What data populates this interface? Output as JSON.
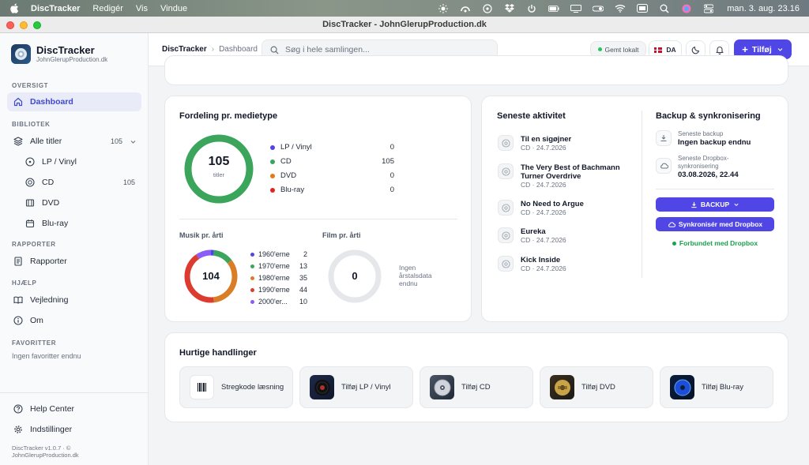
{
  "menubar": {
    "app_name": "DiscTracker",
    "items": [
      "Redigér",
      "Vis",
      "Vindue"
    ],
    "clock": "man. 3. aug.  23.16"
  },
  "window": {
    "title": "DiscTracker - JohnGlerupProduction.dk"
  },
  "sidebar": {
    "brand_title": "DiscTracker",
    "brand_subtitle": "JohnGlerupProduction.dk",
    "sections": {
      "overview": "OVERSIGT",
      "library": "BIBLIOTEK",
      "reports": "RAPPORTER",
      "help": "HJÆLP",
      "favorites": "FAVORITTER"
    },
    "dashboard": "Dashboard",
    "all_titles": {
      "label": "Alle titler",
      "count": "105"
    },
    "library_items": [
      {
        "label": "LP / Vinyl",
        "count": ""
      },
      {
        "label": "CD",
        "count": "105"
      },
      {
        "label": "DVD",
        "count": ""
      },
      {
        "label": "Blu-ray",
        "count": ""
      }
    ],
    "reports": "Rapporter",
    "guide": "Vejledning",
    "about": "Om",
    "favorites_empty": "Ingen favoritter endnu",
    "help_center": "Help Center",
    "settings": "Indstillinger",
    "version_line1": "DiscTracker v1.0.7 · ©",
    "version_line2": "JohnGlerupProduction.dk"
  },
  "topbar": {
    "breadcrumb_root": "DiscTracker",
    "breadcrumb_current": "Dashboard",
    "search_placeholder": "Søg i hele samlingen...",
    "saved_label": "Gemt lokalt",
    "lang": "DA",
    "add_label": "Tilføj"
  },
  "distribution": {
    "title": "Fordeling pr. medietype",
    "total": "105",
    "total_label": "titler",
    "legend": [
      {
        "label": "LP / Vinyl",
        "value": "0",
        "color": "#4f46e5"
      },
      {
        "label": "CD",
        "value": "105",
        "color": "#3ba55c"
      },
      {
        "label": "DVD",
        "value": "0",
        "color": "#e07b1a"
      },
      {
        "label": "Blu-ray",
        "value": "0",
        "color": "#dc2626"
      }
    ],
    "music_title": "Musik pr. årti",
    "music_total": "104",
    "decades": [
      {
        "label": "1960'erne",
        "value": "2",
        "color": "#4f46e5"
      },
      {
        "label": "1970'erne",
        "value": "13",
        "color": "#3ba55c"
      },
      {
        "label": "1980'erne",
        "value": "35",
        "color": "#d97d26"
      },
      {
        "label": "1990'erne",
        "value": "44",
        "color": "#dc3b2f"
      },
      {
        "label": "2000'er...",
        "value": "10",
        "color": "#8b5cf6"
      }
    ],
    "film_title": "Film pr. årti",
    "film_total": "0",
    "film_empty": [
      "Ingen",
      "årstalsdata",
      "endnu"
    ]
  },
  "activity": {
    "title": "Seneste aktivitet",
    "items": [
      {
        "title": "Til en sigøjner",
        "title2": "",
        "sub": "CD · 24.7.2026"
      },
      {
        "title": "The Very Best of Bachmann",
        "title2": "Turner Overdrive",
        "sub": "CD · 24.7.2026"
      },
      {
        "title": "No Need to Argue",
        "title2": "",
        "sub": "CD · 24.7.2026"
      },
      {
        "title": "Eureka",
        "title2": "",
        "sub": "CD · 24.7.2026"
      },
      {
        "title": "Kick Inside",
        "title2": "",
        "sub": "CD · 24.7.2026"
      }
    ]
  },
  "backup": {
    "title": "Backup & synkronisering",
    "last_backup_label": "Seneste backup",
    "last_backup_value": "Ingen backup endnu",
    "last_sync_label1": "Seneste Dropbox-",
    "last_sync_label2": "synkronisering",
    "last_sync_value": "03.08.2026, 22.44",
    "backup_button": "BACKUP",
    "sync_button": "Synkronisér med Dropbox",
    "connected": "Forbundet med Dropbox"
  },
  "quick": {
    "title": "Hurtige handlinger",
    "actions": [
      {
        "label": "Stregkode læsning",
        "icon": "barcode-icon"
      },
      {
        "label": "Tilføj LP / Vinyl",
        "icon": "vinyl-icon"
      },
      {
        "label": "Tilføj CD",
        "icon": "cd-icon"
      },
      {
        "label": "Tilføj DVD",
        "icon": "dvd-icon"
      },
      {
        "label": "Tilføj Blu-ray",
        "icon": "bluray-icon"
      }
    ]
  },
  "colors": {
    "accent": "#4f46e5",
    "active_bg": "#e9ecf8",
    "success": "#16a34a"
  }
}
